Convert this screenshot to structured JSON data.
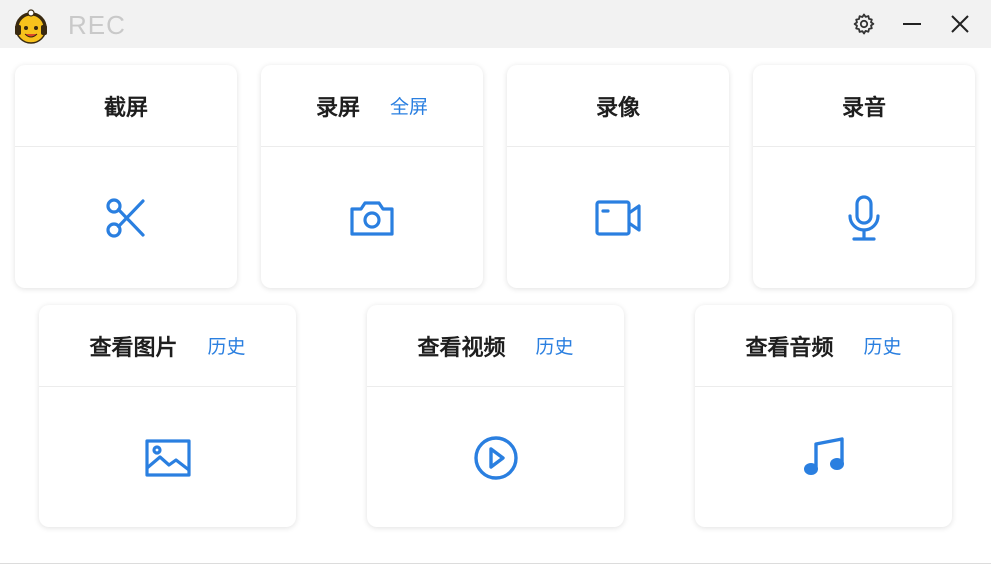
{
  "app": {
    "title": "REC"
  },
  "colors": {
    "accent": "#2a7fe0",
    "title_text": "#1e1e1e"
  },
  "titlebar": {
    "buttons": [
      {
        "name": "settings",
        "icon": "gear-icon"
      },
      {
        "name": "minimize",
        "icon": "minimize-icon"
      },
      {
        "name": "close",
        "icon": "close-icon"
      }
    ]
  },
  "cards_top": [
    {
      "title": "截屏",
      "link": "",
      "icon": "scissors-icon"
    },
    {
      "title": "录屏",
      "link": "全屏",
      "icon": "camera-icon"
    },
    {
      "title": "录像",
      "link": "",
      "icon": "video-icon"
    },
    {
      "title": "录音",
      "link": "",
      "icon": "microphone-icon"
    }
  ],
  "cards_bottom": [
    {
      "title": "查看图片",
      "link": "历史",
      "icon": "image-icon"
    },
    {
      "title": "查看视频",
      "link": "历史",
      "icon": "play-icon"
    },
    {
      "title": "查看音频",
      "link": "历史",
      "icon": "music-icon"
    }
  ]
}
